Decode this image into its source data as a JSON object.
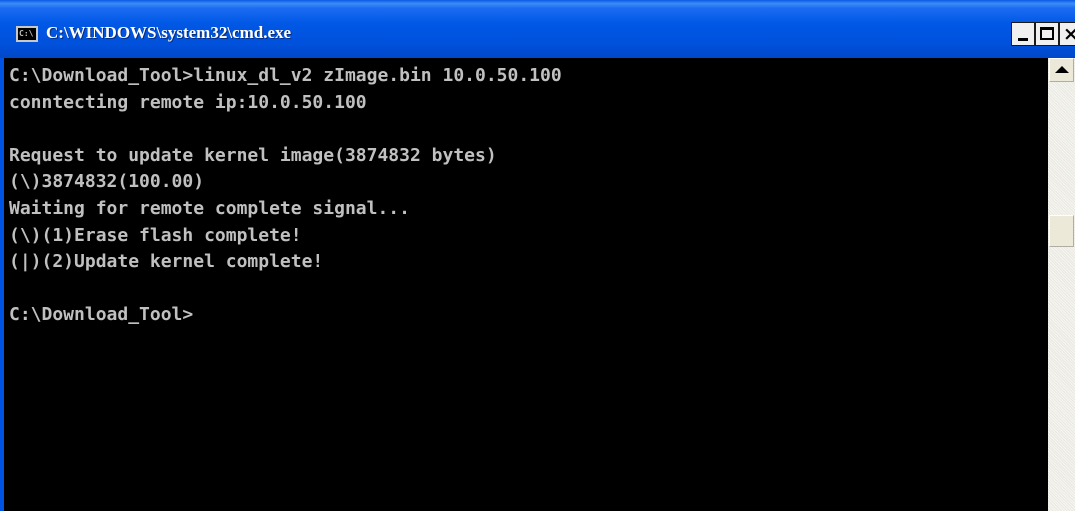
{
  "window": {
    "title": "C:\\WINDOWS\\system32\\cmd.exe",
    "icon": "cmd-app-icon",
    "icon_text": "C:\\"
  },
  "controls": {
    "minimize_icon": "minimize-icon",
    "maximize_icon": "maximize-icon",
    "close_icon": "close-icon",
    "close_glyph": "×"
  },
  "console": {
    "text_color": "#c0c0c0",
    "background": "#000000",
    "lines": [
      "C:\\Download_Tool>linux_dl_v2 zImage.bin 10.0.50.100",
      "conntecting remote ip:10.0.50.100",
      "",
      "Request to update kernel image(3874832 bytes)",
      "(\\)3874832(100.00)",
      "Waiting for remote complete signal...",
      "(\\)(1)Erase flash complete!",
      "(|)(2)Update kernel complete!",
      "",
      "C:\\Download_Tool>"
    ]
  },
  "scrollbar": {
    "up_icon": "scroll-up-arrow-icon"
  },
  "colors": {
    "titlebar": "#0054e3",
    "title_text": "#ffffff",
    "console_bg": "#000000",
    "console_text": "#c0c0c0"
  }
}
